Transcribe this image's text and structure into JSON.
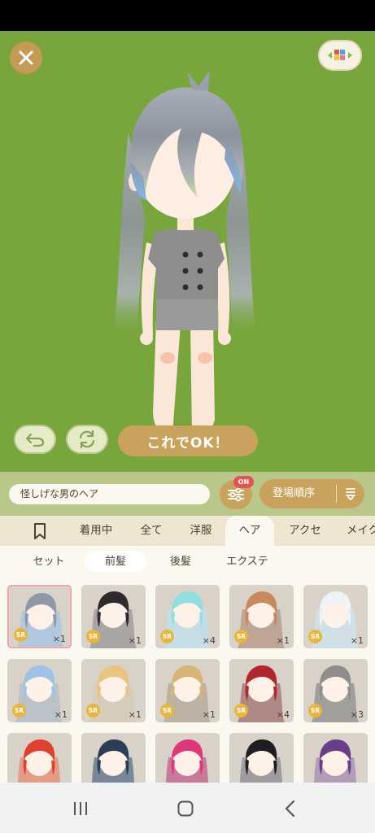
{
  "stage": {
    "background": "#78a63c",
    "ok_label": "これでOK！"
  },
  "search": {
    "name_value": "怪しげな男のヘア",
    "filter_badge": "ON",
    "sort_label": "登場順序"
  },
  "category_tabs": {
    "bookmark": "bookmark-icon",
    "items": [
      "着用中",
      "全て",
      "洋服",
      "ヘア",
      "アクセ",
      "メイク"
    ],
    "active": "ヘア"
  },
  "sub_tabs": {
    "items": [
      "セット",
      "前髪",
      "後髪",
      "エクステ"
    ],
    "active": "前髪"
  },
  "items": [
    {
      "hair": "#8f98a6",
      "tip": "#a6c4e8",
      "rarity": "SR",
      "count": "×1",
      "selected": true
    },
    {
      "hair": "#2e2a2c",
      "tip": "#9a969a",
      "rarity": "SR",
      "count": "×1"
    },
    {
      "hair": "#8fe0df",
      "tip": "#bfe0ef",
      "rarity": "SR",
      "count": "×4"
    },
    {
      "hair": "#c88a5a",
      "tip": "#b59584",
      "rarity": "SR",
      "count": "×1"
    },
    {
      "hair": "#eef3f7",
      "tip": "#cfe3f2",
      "rarity": "SR",
      "count": "×1"
    },
    {
      "hair": "#9ec3e6",
      "tip": "#b3bdc8",
      "rarity": "SR",
      "count": "×1"
    },
    {
      "hair": "#e9c47f",
      "tip": "#d6cbb9",
      "rarity": "SR",
      "count": "×1"
    },
    {
      "hair": "#d8b479",
      "tip": "#b4a89a",
      "rarity": "SR",
      "count": "×1"
    },
    {
      "hair": "#b3262b",
      "tip": "#a07070",
      "rarity": "SR",
      "count": "×4"
    },
    {
      "hair": "#8f8d8e",
      "tip": "#8f8d8e",
      "rarity": "SR",
      "count": "×3"
    },
    {
      "hair": "#e2402f",
      "tip": "#e58b6c",
      "rarity": "",
      "count": ""
    },
    {
      "hair": "#2a3e56",
      "tip": "#5a6f88",
      "rarity": "",
      "count": ""
    },
    {
      "hair": "#e2357a",
      "tip": "#c35b8d",
      "rarity": "",
      "count": ""
    },
    {
      "hair": "#1f1d21",
      "tip": "#8c8894",
      "rarity": "",
      "count": ""
    },
    {
      "hair": "#6a3d8a",
      "tip": "#a58bb0",
      "rarity": "",
      "count": ""
    }
  ],
  "nav": {
    "recents": "recent-apps-icon",
    "home": "home-icon",
    "back": "back-icon"
  }
}
